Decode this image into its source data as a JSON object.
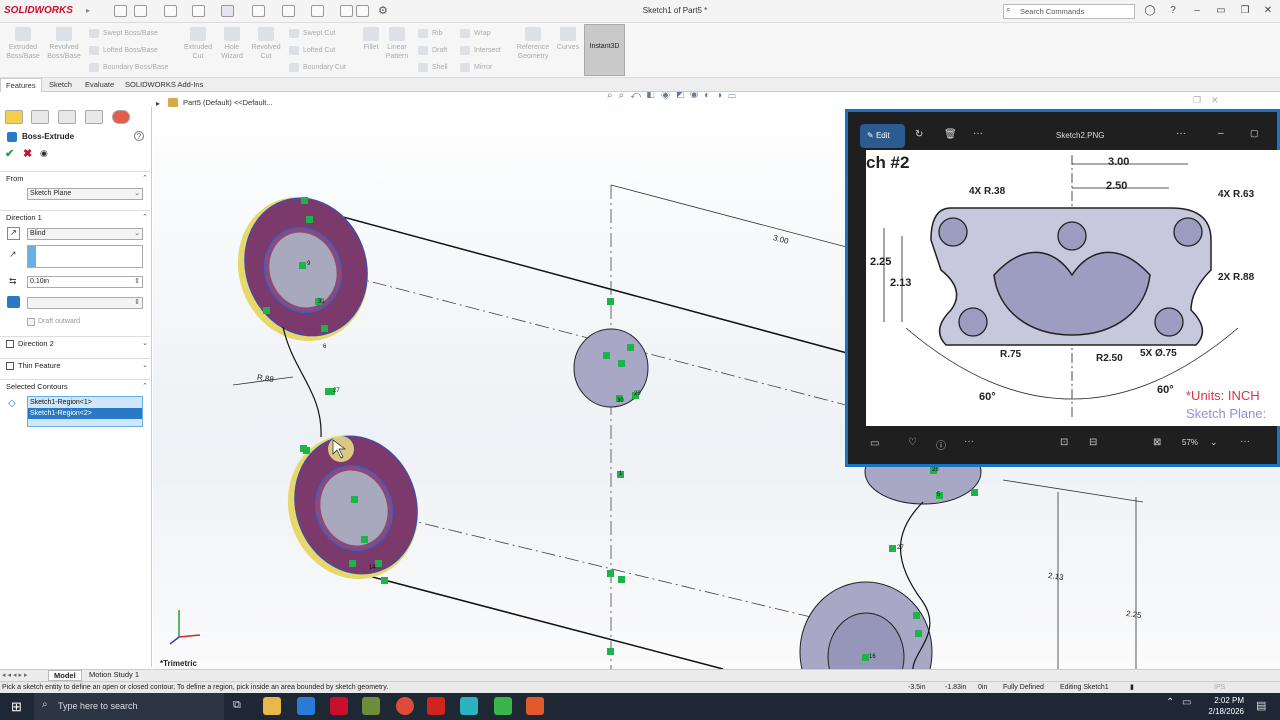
{
  "titlebar": {
    "app_logo": "SOLIDWORKS",
    "document_title": "Sketch1 of Part5 *",
    "search_placeholder": "Search Commands"
  },
  "toolbar": {
    "tools": [
      {
        "label1": "Extruded",
        "label2": "Boss/Base"
      },
      {
        "label1": "Revolved",
        "label2": "Boss/Base"
      },
      {
        "label1": "Extruded",
        "label2": "Cut"
      },
      {
        "label1": "Hole",
        "label2": "Wizard"
      },
      {
        "label1": "Revolved",
        "label2": "Cut"
      },
      {
        "label1": "Fillet",
        "label2": ""
      },
      {
        "label1": "Linear",
        "label2": "Pattern"
      },
      {
        "label1": "Reference",
        "label2": "Geometry"
      },
      {
        "label1": "Curves",
        "label2": ""
      }
    ],
    "small_tools": [
      "Swept Boss/Base",
      "Lofted Boss/Base",
      "Boundary Boss/Base",
      "Swept Cut",
      "Lofted Cut",
      "Boundary Cut",
      "Rib",
      "Draft",
      "Shell",
      "Wrap",
      "Intersect",
      "Mirror"
    ],
    "instant3d": "Instant3D"
  },
  "tabs": [
    "Features",
    "Sketch",
    "Evaluate",
    "SOLIDWORKS Add-Ins"
  ],
  "tree_breadcrumb": "Part5 (Default) <<Default...",
  "property_manager": {
    "title": "Boss-Extrude",
    "from_label": "From",
    "from_value": "Sketch Plane",
    "direction1_label": "Direction 1",
    "end_condition": "Blind",
    "depth": "0.10in",
    "draft_outward": "Draft outward",
    "direction2_label": "Direction 2",
    "thin_feature_label": "Thin Feature",
    "selected_contours_label": "Selected Contours",
    "contours": [
      "Sketch1-Region<1>",
      "Sketch1-Region<2>"
    ]
  },
  "viewport": {
    "view_name": "*Trimetric",
    "dim_300": "3.00",
    "dim_r88": "R.88",
    "dim_213": "2.13",
    "dim_225": "2.25",
    "markers": [
      "27",
      "31",
      "6",
      "30",
      "29",
      "1",
      "28",
      "5",
      "27",
      "16",
      "9",
      "14"
    ]
  },
  "photos": {
    "edit_label": "Edit",
    "file_name": "Sketch2.PNG",
    "zoom": "57%",
    "drawing": {
      "title": "ch #2",
      "dim_300": "3.00",
      "dim_250": "2.50",
      "dim_4xr38": "4X R.38",
      "dim_4xr63": "4X R.63",
      "dim_225": "2.25",
      "dim_213": "2.13",
      "dim_2xr88": "2X R.88",
      "dim_r75": "R.75",
      "dim_r250": "R2.50",
      "dim_5xd75": "5X Ø.75",
      "angle_left": "60°",
      "angle_right": "60°",
      "units": "*Units: INCH",
      "sketch_plane": "Sketch Plane:"
    }
  },
  "bottom_tabs": [
    "Model",
    "Motion Study 1"
  ],
  "status": {
    "hint": "Pick a sketch entity to define an open or closed contour. To define a region, pick inside an area bounded by sketch geometry.",
    "x": "-3.5in",
    "y": "-1.83in",
    "z": "0in",
    "state": "Fully Defined",
    "editing": "Editing Sketch1",
    "units": "IPS"
  },
  "taskbar": {
    "search_placeholder": "Type here to search",
    "time": "2:02 PM",
    "date": "2/18/2026"
  },
  "colors": {
    "accent": "#1a72c4",
    "feature_face": "#7b3a6b",
    "sketch_green": "#1db34a",
    "units_red": "#d9324a",
    "plane_blue": "#8f8fd6"
  }
}
